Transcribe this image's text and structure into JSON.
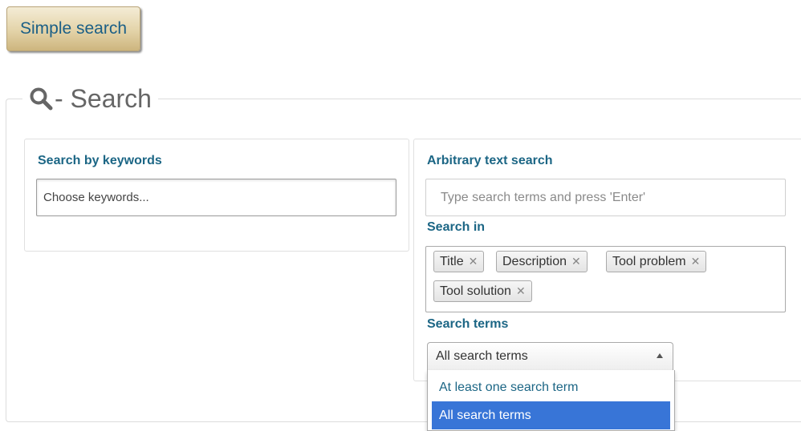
{
  "simple_search_button": "Simple search",
  "section": {
    "title": "- Search",
    "icon": "search-icon"
  },
  "keywords": {
    "heading": "Search by keywords",
    "placeholder": "Choose keywords..."
  },
  "arbitrary": {
    "heading": "Arbitrary text search",
    "placeholder": "Type search terms and press 'Enter'",
    "search_in_label": "Search in",
    "tags": [
      "Title",
      "Description",
      "Tool problem",
      "Tool solution"
    ],
    "tag_remove_symbol": "✕",
    "search_terms_label": "Search terms",
    "search_terms_selected": "All search terms",
    "search_terms_options": [
      "At least one search term",
      "All search terms"
    ]
  },
  "colors": {
    "heading": "#1c6685",
    "button_text": "#1b5f86",
    "highlight": "#3875d7"
  }
}
